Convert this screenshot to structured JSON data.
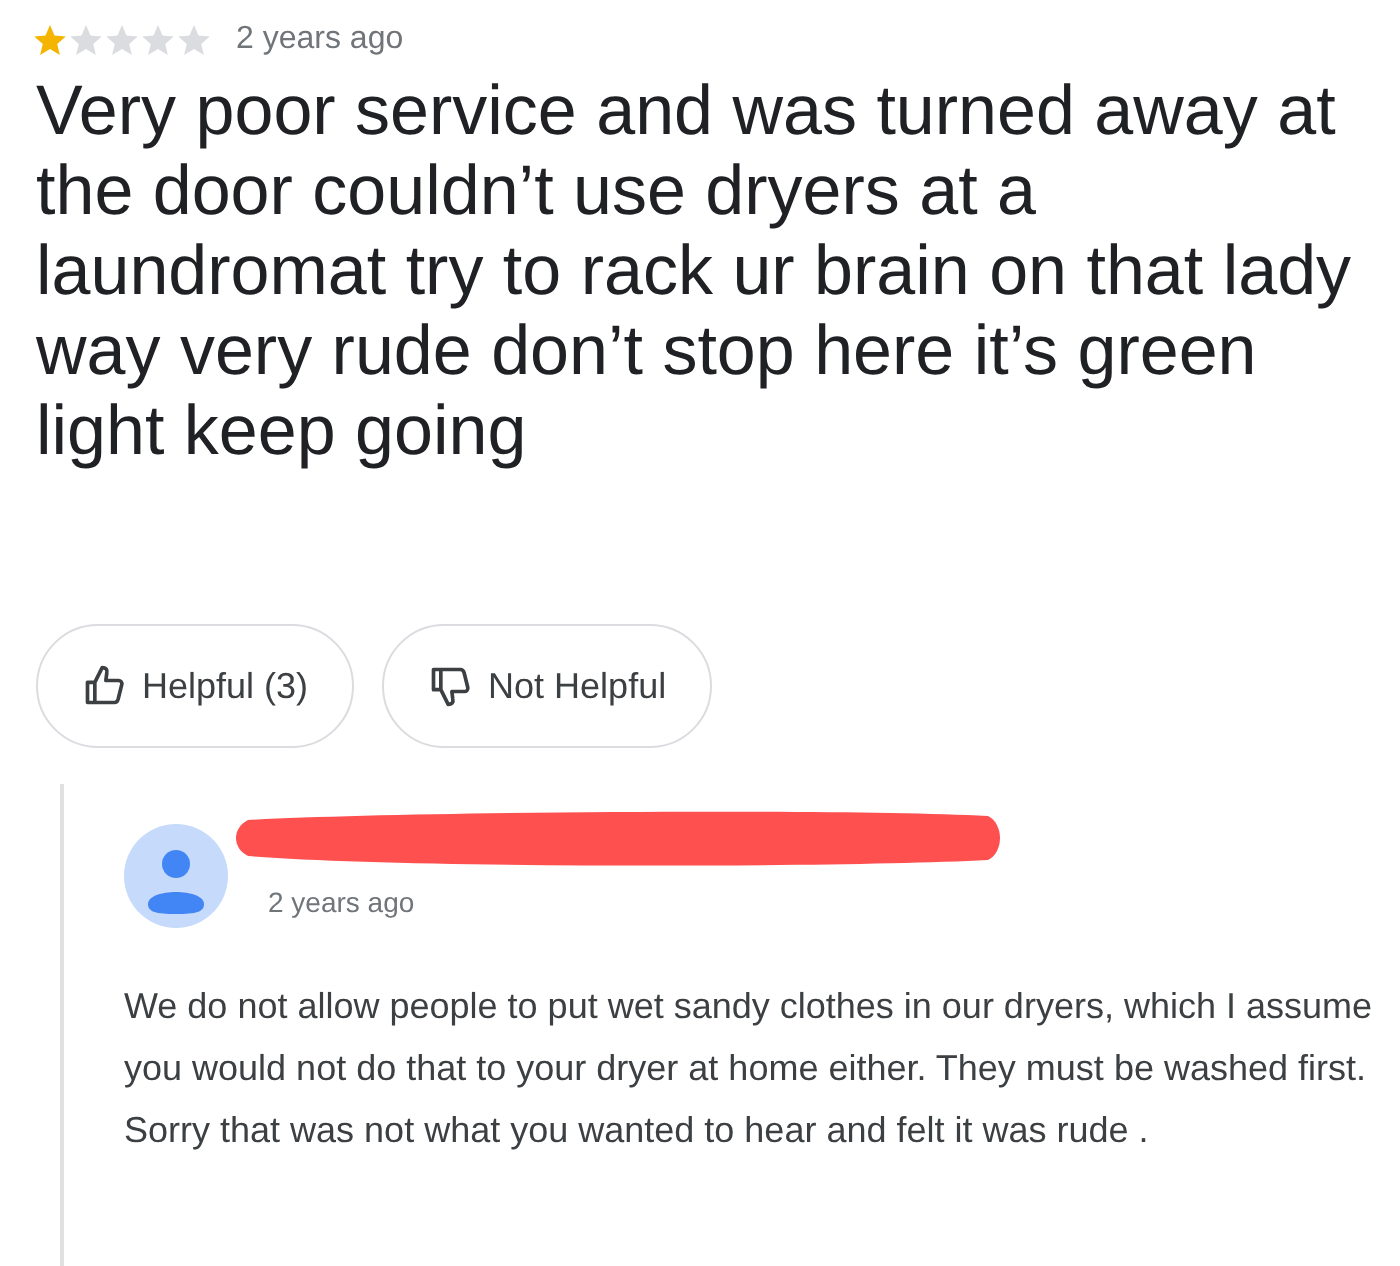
{
  "review": {
    "stars": 1,
    "time": "2 years ago",
    "text": "Very poor service and was turned away at the door couldn’t use dryers at a laundromat try to rack ur brain on that lady way very rude don’t stop here it’s green light keep going"
  },
  "buttons": [
    {
      "kind": "up",
      "label": "Helpful (3)"
    },
    {
      "kind": "down",
      "label": "Not Helpful"
    }
  ],
  "reply": {
    "time": "2 years ago",
    "text": "We do not allow people to put wet sandy clothes in our dryers, which I assume you would not do that to your dryer at home either. They must be washed first.  Sorry that was not what you wanted to hear and felt it was rude ."
  }
}
